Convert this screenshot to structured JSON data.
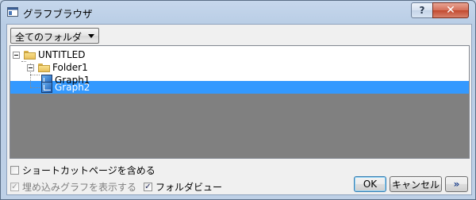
{
  "window": {
    "title": "グラフブラウザ",
    "help_label": "?",
    "close_label": "✕"
  },
  "folder_select": {
    "value": "全てのフォルダ"
  },
  "tree": {
    "items": [
      {
        "label": "UNTITLED",
        "type": "folder",
        "level": 0,
        "expanded": true
      },
      {
        "label": "Folder1",
        "type": "folder",
        "level": 1,
        "expanded": true
      },
      {
        "label": "Graph1",
        "type": "graph",
        "level": 2
      },
      {
        "label": "Graph2",
        "type": "graph",
        "level": 2,
        "selected": true
      }
    ]
  },
  "options": {
    "include_shortcut": {
      "label": "ショートカットページを含める",
      "checked": false
    },
    "show_embedded": {
      "label": "埋め込みグラフを表示する",
      "checked": true,
      "disabled": true
    },
    "folder_view": {
      "label": "フォルダビュー",
      "checked": true
    }
  },
  "buttons": {
    "ok": "OK",
    "cancel": "キャンセル",
    "more": "»"
  },
  "colors": {
    "selection": "#3399ff",
    "tree_background": "#808080"
  }
}
